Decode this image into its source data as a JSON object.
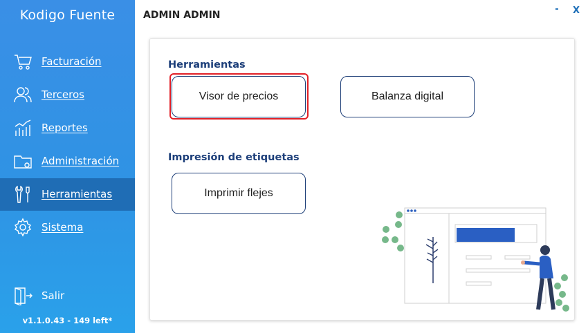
{
  "app": {
    "brand": "Kodigo Fuente",
    "version": "v1.1.0.43 - 149 left*"
  },
  "sidebar": {
    "items": [
      {
        "label": "Facturación",
        "icon": "cart-icon"
      },
      {
        "label": "Terceros",
        "icon": "users-icon"
      },
      {
        "label": "Reportes",
        "icon": "chart-icon"
      },
      {
        "label": "Administración",
        "icon": "folder-icon"
      },
      {
        "label": "Herramientas",
        "icon": "tools-icon",
        "active": true
      },
      {
        "label": "Sistema",
        "icon": "gear-icon"
      }
    ],
    "exit": {
      "label": "Salir",
      "icon": "exit-door-icon"
    }
  },
  "header": {
    "title": "ADMIN ADMIN",
    "minimize": "-",
    "close": "X"
  },
  "main": {
    "sections": [
      {
        "title": "Herramientas",
        "buttons": [
          "Visor de precios",
          "Balanza digital"
        ]
      },
      {
        "title": "Impresión de etiquetas",
        "buttons": [
          "Imprimir flejes"
        ]
      }
    ]
  },
  "colors": {
    "sidebar": "#3a8fe6",
    "active": "#1f6db5",
    "accent": "#1d3f7a",
    "focus": "#e21f26"
  }
}
